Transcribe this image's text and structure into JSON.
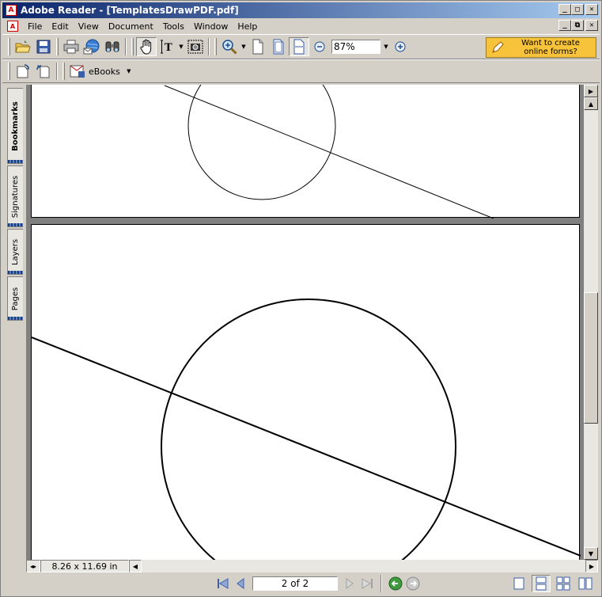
{
  "window": {
    "title": "Adobe Reader - [TemplatesDrawPDF.pdf]",
    "app_icon": "acrobat-icon",
    "minimize": "_",
    "maximize": "□",
    "close": "✕"
  },
  "menu": {
    "items": [
      "File",
      "Edit",
      "View",
      "Document",
      "Tools",
      "Window",
      "Help"
    ],
    "doc_restore": "⧉"
  },
  "toolbar": {
    "zoom_value": "87%",
    "forms_line1": "Want to create",
    "forms_line2": "online forms?",
    "ebooks_label": "eBooks"
  },
  "side_tabs": [
    "Bookmarks",
    "Signatures",
    "Layers",
    "Pages"
  ],
  "status": {
    "page_size": "8.26 x 11.69 in"
  },
  "navigation": {
    "page_indicator": "2 of 2"
  },
  "colors": {
    "titlebar_start": "#0a246a",
    "titlebar_end": "#a6caf0",
    "forms_button": "#f7c33b",
    "chrome": "#d4d0c8"
  }
}
